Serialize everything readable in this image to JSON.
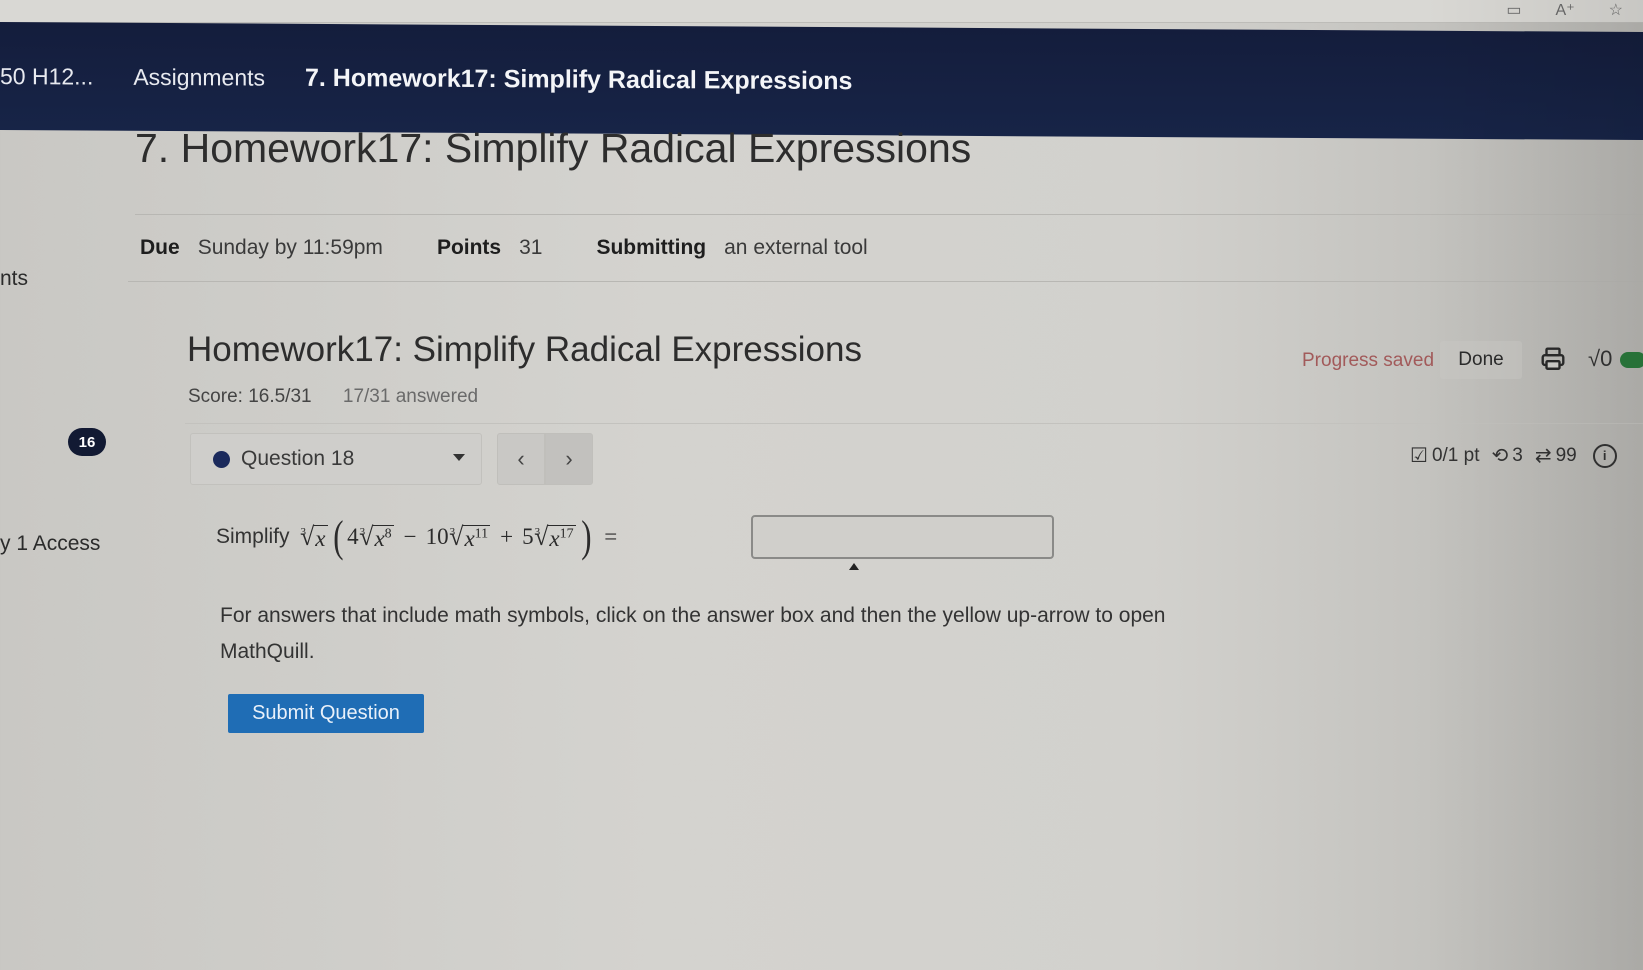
{
  "browser": {
    "icons": [
      "reader-view-icon",
      "text-size-icon",
      "favorite-star-icon"
    ],
    "icon_glyphs": [
      "▭",
      "A⁺",
      "☆"
    ]
  },
  "breadcrumb": {
    "items": [
      "50 H12...",
      "Assignments",
      "7. Homework17: Simplify Radical Expressions"
    ]
  },
  "assignment": {
    "title": "7. Homework17: Simplify Radical Expressions",
    "due_label": "Due",
    "due_value": "Sunday by 11:59pm",
    "points_label": "Points",
    "points_value": "31",
    "submitting_label": "Submitting",
    "submitting_value": "an external tool"
  },
  "sidebar": {
    "partial_item": "nts",
    "access_item": "y 1 Access",
    "badge_count": "16"
  },
  "homework": {
    "title": "Homework17: Simplify Radical Expressions",
    "score": "Score: 16.5/31",
    "answered": "17/31 answered",
    "progress_status": "Progress saved",
    "done_label": "Done",
    "status_color": "#a25a5a"
  },
  "question_nav": {
    "selected_question": "Question 18",
    "prev_glyph": "‹",
    "next_glyph": "›",
    "points": "0/1 pt",
    "retries": "3",
    "attempts": "99"
  },
  "problem": {
    "lead": "Simplify",
    "radical_index": "3",
    "outer_radicand": "x",
    "terms": [
      {
        "coef": "4",
        "radicand": "x",
        "exp": "8",
        "sign": ""
      },
      {
        "coef": "10",
        "radicand": "x",
        "exp": "11",
        "sign": "−"
      },
      {
        "coef": "5",
        "radicand": "x",
        "exp": "17",
        "sign": "+"
      }
    ],
    "equals": "=",
    "answer_value": ""
  },
  "instructions": "For answers that include math symbols, click on the answer box and then the yellow up-arrow to open MathQuill.",
  "submit_label": "Submit Question",
  "colors": {
    "nav_bg": "#172447",
    "submit_bg": "#1f6db5",
    "question_dot": "#1b2a5c"
  }
}
